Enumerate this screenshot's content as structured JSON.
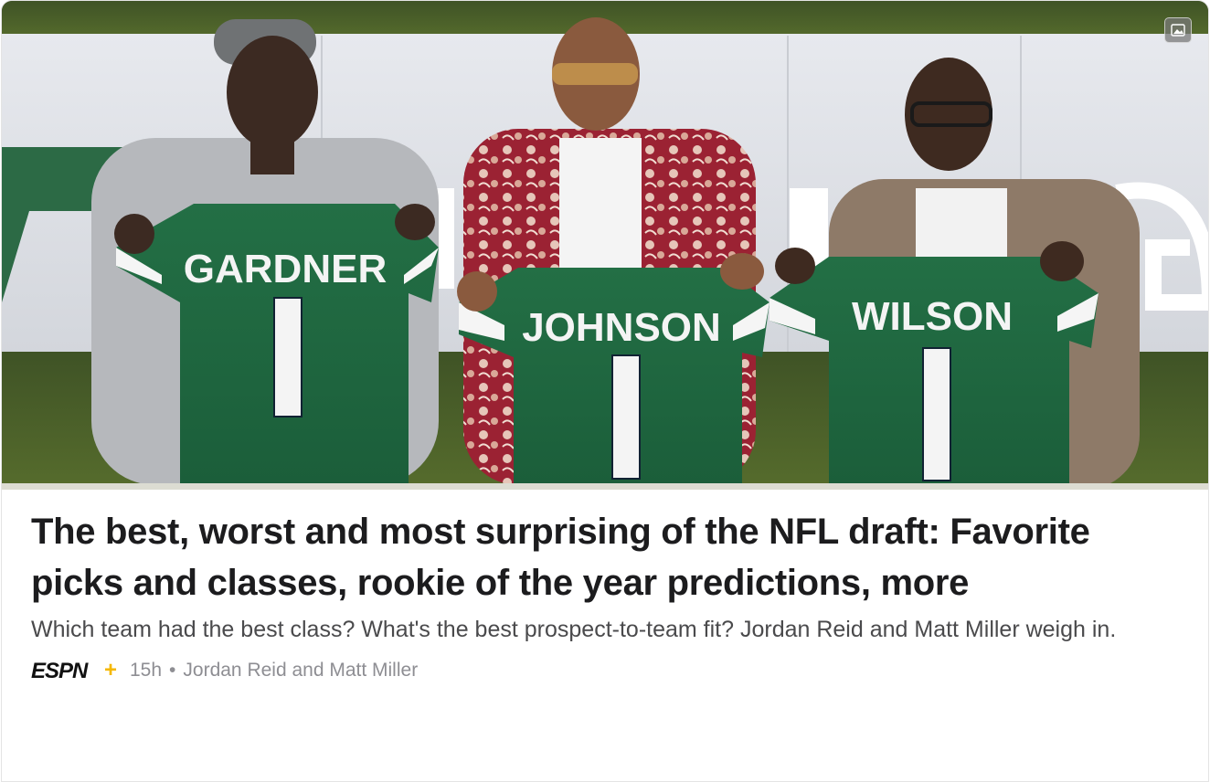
{
  "hero": {
    "jerseys": [
      {
        "name": "GARDNER",
        "number": "1"
      },
      {
        "name": "JOHNSON",
        "number": "1"
      },
      {
        "name": "WILSON",
        "number": "1"
      }
    ],
    "icon": "image-gallery-icon"
  },
  "article": {
    "headline": "The best, worst and most surprising of the NFL draft: Favorite picks and classes, rookie of the year predictions, more",
    "dek": "Which team had the best class? What's the best prospect-to-team fit? Jordan Reid and Matt Miller weigh in.",
    "source_logo_text": "ESPN",
    "source_logo_plus": "+",
    "time_ago": "15h",
    "separator": "•",
    "authors": "Jordan Reid and Matt Miller"
  },
  "colors": {
    "jersey_green": "#1f6b41",
    "espn_plus_yellow": "#f5b800",
    "headline": "#1c1c1e",
    "meta": "#8e8e93"
  }
}
